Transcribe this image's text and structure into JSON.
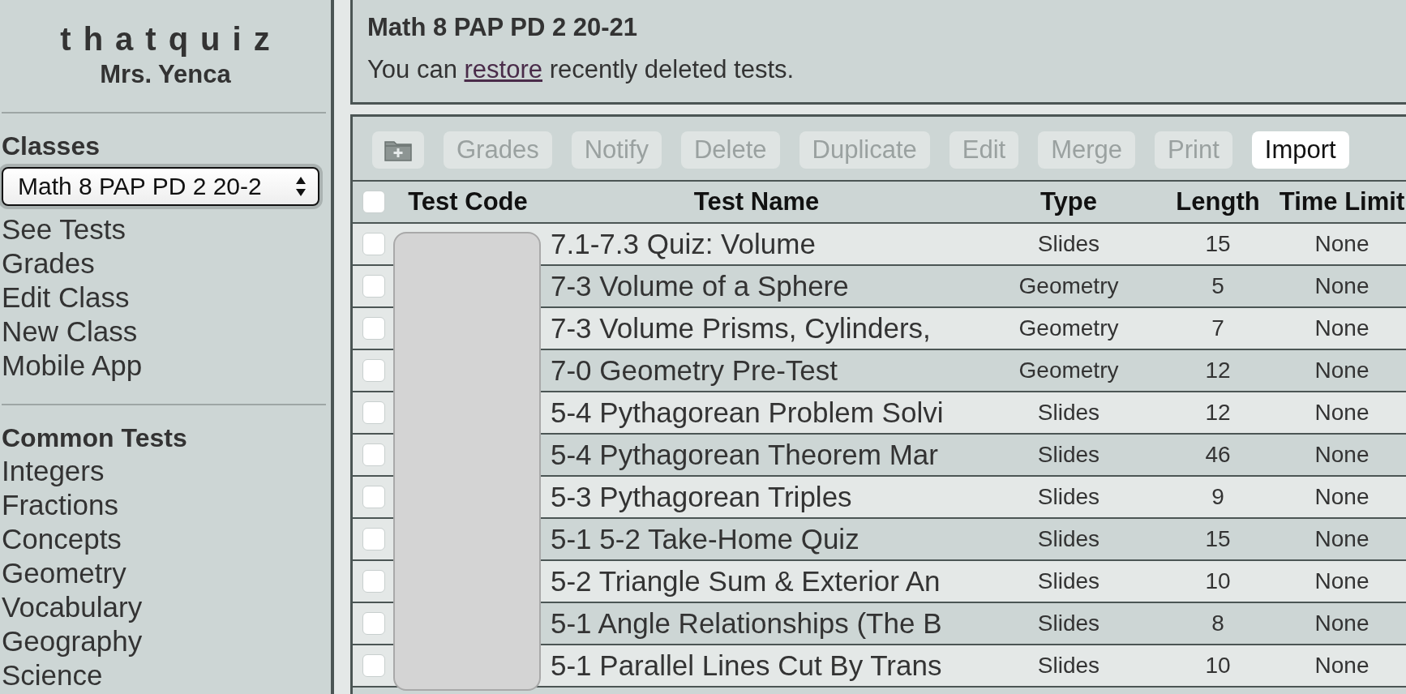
{
  "sidebar": {
    "logo": "thatquiz",
    "teacher": "Mrs. Yenca",
    "classes_heading": "Classes",
    "class_select": {
      "value": "Math 8 PAP PD 2 20-2"
    },
    "class_links": [
      "See Tests",
      "Grades",
      "Edit Class",
      "New Class",
      "Mobile App"
    ],
    "common_heading": "Common Tests",
    "common_links": [
      "Integers",
      "Fractions",
      "Concepts",
      "Geometry",
      "Vocabulary",
      "Geography",
      "Science"
    ]
  },
  "header": {
    "title": "Math 8 PAP PD 2 20-21",
    "message": {
      "before": "You can",
      "link": "restore",
      "after": "recently deleted tests."
    }
  },
  "toolbar": {
    "folder_disabled": true,
    "buttons": [
      {
        "label": "Grades",
        "disabled": true
      },
      {
        "label": "Notify",
        "disabled": true
      },
      {
        "label": "Delete",
        "disabled": true
      },
      {
        "label": "Duplicate",
        "disabled": true
      },
      {
        "label": "Edit",
        "disabled": true
      },
      {
        "label": "Merge",
        "disabled": true
      },
      {
        "label": "Print",
        "disabled": true
      },
      {
        "label": "Import",
        "disabled": false
      }
    ]
  },
  "table": {
    "all_checked": false,
    "columns": [
      "Test Code",
      "Test Name",
      "Type",
      "Length",
      "Time Limit"
    ],
    "rows": [
      {
        "checked": false,
        "name": "7.1-7.3 Quiz: Volume",
        "type": "Slides",
        "length": "15",
        "time_limit": "None"
      },
      {
        "checked": false,
        "name": "7-3 Volume of a Sphere",
        "type": "Geometry",
        "length": "5",
        "time_limit": "None"
      },
      {
        "checked": false,
        "name": "7-3 Volume Prisms, Cylinders,",
        "type": "Geometry",
        "length": "7",
        "time_limit": "None"
      },
      {
        "checked": false,
        "name": "7-0 Geometry Pre-Test",
        "type": "Geometry",
        "length": "12",
        "time_limit": "None"
      },
      {
        "checked": false,
        "name": "5-4 Pythagorean Problem Solvi",
        "type": "Slides",
        "length": "12",
        "time_limit": "None"
      },
      {
        "checked": false,
        "name": "5-4 Pythagorean Theorem Mar",
        "type": "Slides",
        "length": "46",
        "time_limit": "None"
      },
      {
        "checked": false,
        "name": "5-3 Pythagorean Triples",
        "type": "Slides",
        "length": "9",
        "time_limit": "None"
      },
      {
        "checked": false,
        "name": "5-1 5-2 Take-Home Quiz",
        "type": "Slides",
        "length": "15",
        "time_limit": "None"
      },
      {
        "checked": false,
        "name": "5-2 Triangle Sum & Exterior An",
        "type": "Slides",
        "length": "10",
        "time_limit": "None"
      },
      {
        "checked": false,
        "name": "5-1 Angle Relationships (The B",
        "type": "Slides",
        "length": "8",
        "time_limit": "None"
      },
      {
        "checked": false,
        "name": "5-1 Parallel Lines Cut By Trans",
        "type": "Slides",
        "length": "10",
        "time_limit": "None"
      }
    ]
  }
}
